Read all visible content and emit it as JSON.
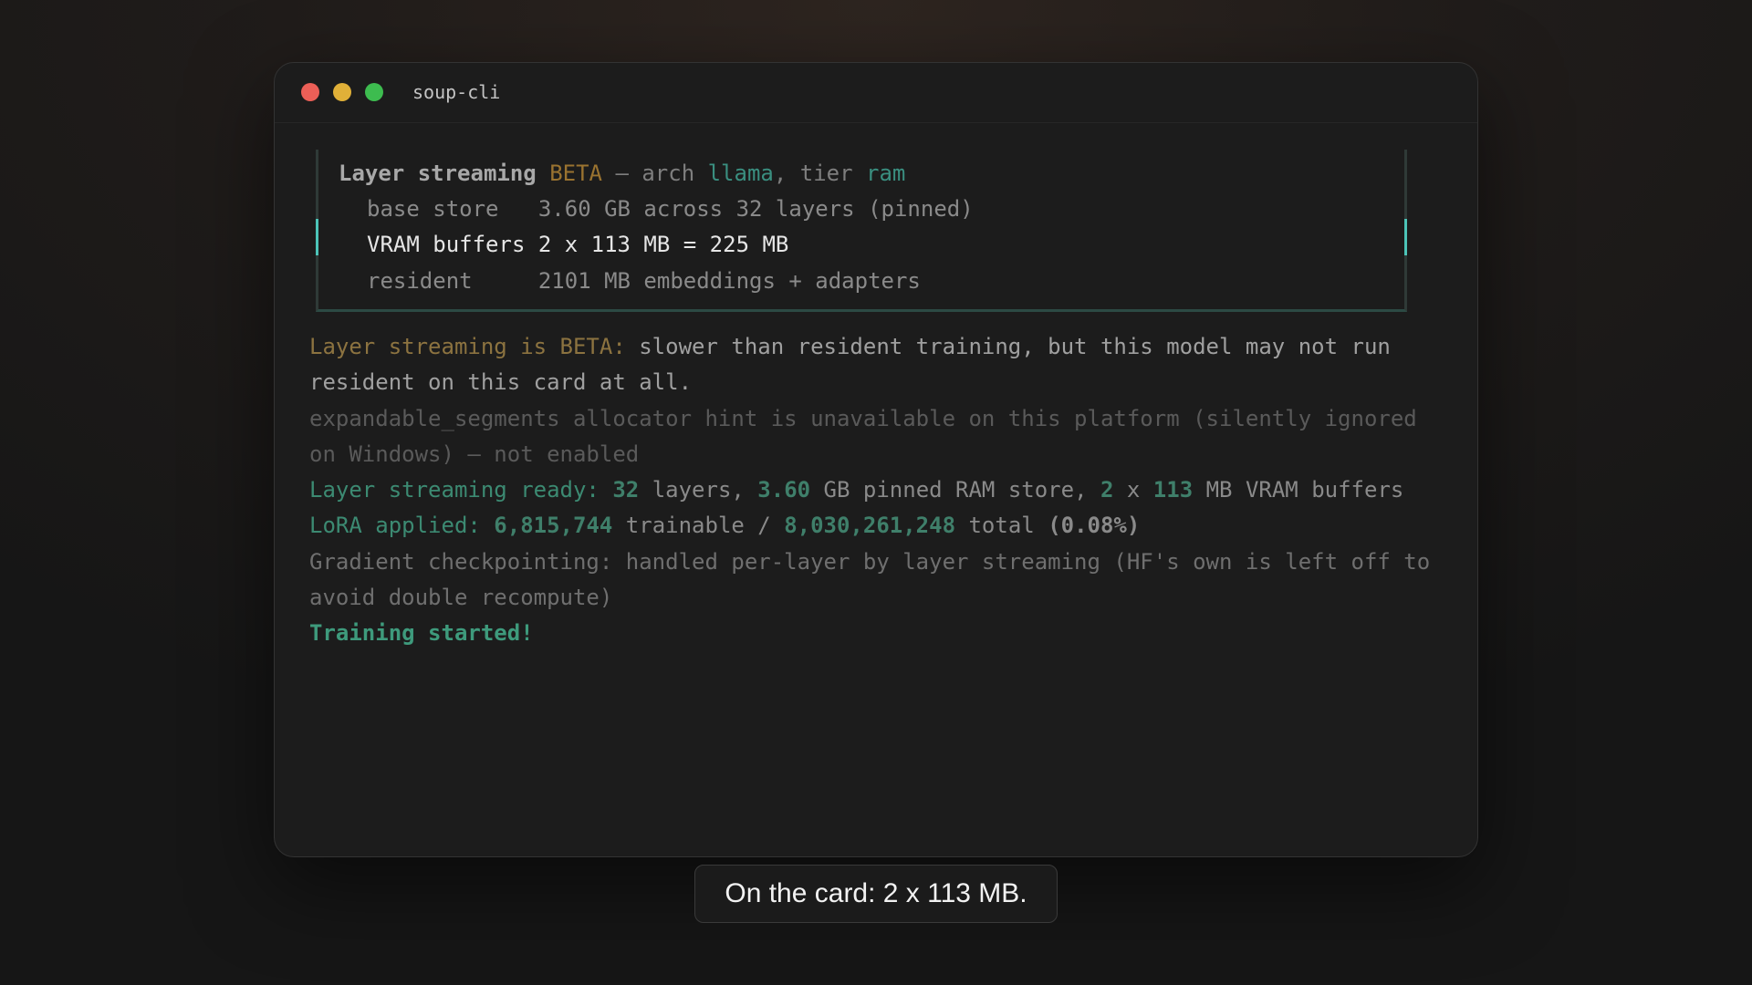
{
  "window": {
    "title": "soup-cli"
  },
  "panel": {
    "line1": {
      "title": "Layer streaming",
      "badge": "BETA",
      "sep": " — ",
      "arch_label": "arch ",
      "arch": "llama",
      "tier_label": ", tier ",
      "tier": "ram"
    },
    "line2": {
      "key": "base store  ",
      "value": " 3.60 GB across 32 layers (pinned)"
    },
    "line3": {
      "key": "VRAM buffers",
      "value": " 2 x 113 MB = 225 MB"
    },
    "line4": {
      "key": "resident    ",
      "value": " 2101 MB embeddings + adapters"
    }
  },
  "log": {
    "beta_label": "Layer streaming is BETA:",
    "beta_text": " slower than resident training, but this model may not run resident on this card at all.",
    "alloc_text": "expandable_segments allocator hint is unavailable on this platform (silently ignored on Windows) — not enabled",
    "ready_label": "Layer streaming ready:",
    "ready_layers": "32",
    "ready_mid1": " layers, ",
    "ready_gb": "3.60",
    "ready_mid2": " GB pinned RAM store, ",
    "ready_n": "2",
    "ready_x": " x ",
    "ready_mb": "113",
    "ready_end": " MB VRAM buffers",
    "lora_label": "LoRA applied:",
    "lora_trainable": "6,815,744",
    "lora_mid": " trainable / ",
    "lora_total": "8,030,261,248",
    "lora_total_label": " total ",
    "lora_pct": "(0.08%)",
    "grad_text": "Gradient checkpointing: handled per-layer by layer streaming (HF's own is left off to avoid double recompute)",
    "started_text": "Training started!"
  },
  "caption": {
    "text": "On the card: 2 x 113 MB."
  },
  "colors": {
    "accent_teal": "#4cc4b8",
    "beta": "#9a7330",
    "red_dot": "#ec5f57",
    "yellow_dot": "#e0b038",
    "green_dot": "#3dbc4f"
  }
}
